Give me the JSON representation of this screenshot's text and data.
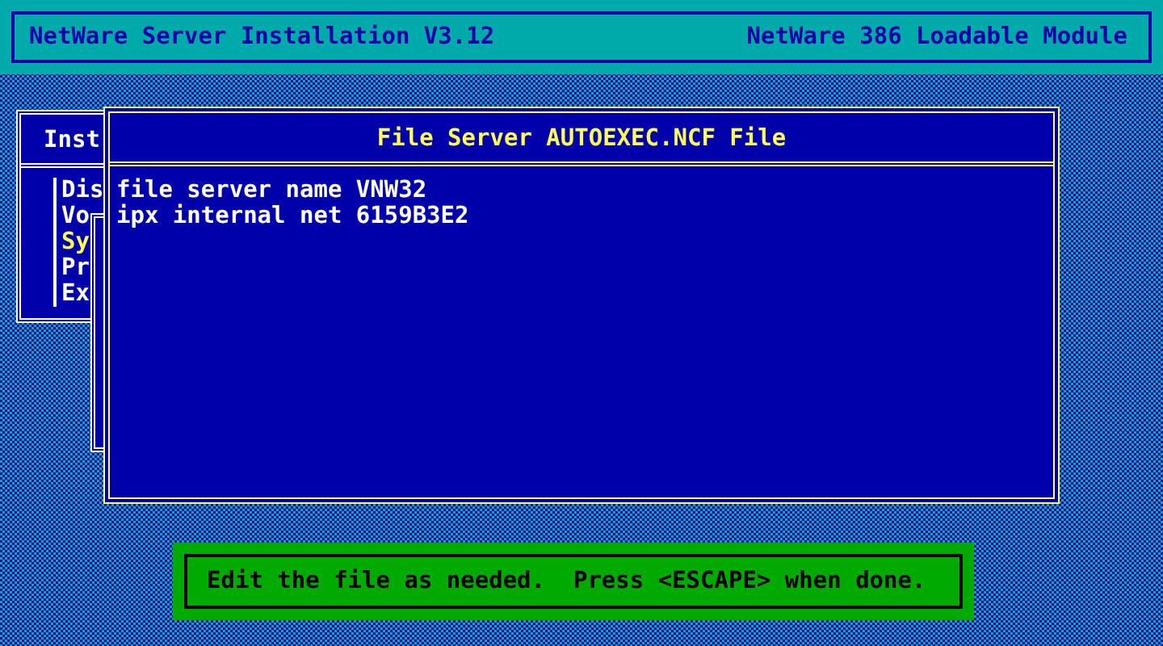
{
  "header": {
    "title": "NetWare Server Installation V3.12",
    "module": "NetWare 386 Loadable Module"
  },
  "menu": {
    "title": "Inst",
    "items": [
      {
        "label": "Dis",
        "selected": false
      },
      {
        "label": "Vo",
        "selected": false
      },
      {
        "label": "Sy",
        "selected": true
      },
      {
        "label": "Pr",
        "selected": false
      },
      {
        "label": "Ex",
        "selected": false
      }
    ]
  },
  "editor": {
    "title": "File Server AUTOEXEC.NCF File",
    "lines": [
      "file server name VNW32",
      "ipx internal net 6159B3E2"
    ]
  },
  "status": "Edit the file as needed.  Press <ESCAPE> when done."
}
